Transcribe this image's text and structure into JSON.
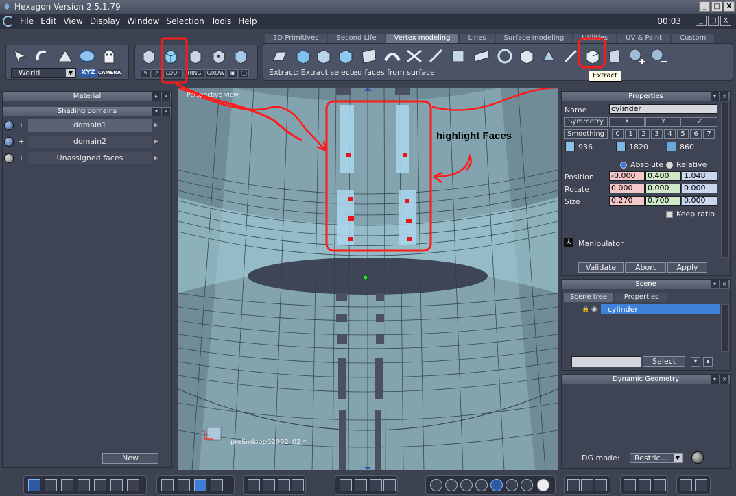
{
  "window": {
    "title": "Hexagon Version 2.5.1.79"
  },
  "menu": {
    "items": [
      "File",
      "Edit",
      "View",
      "Display",
      "Window",
      "Selection",
      "Tools",
      "Help"
    ],
    "timer": "00:03"
  },
  "tabs": [
    "3D Primitives",
    "Second Life",
    "Vertex modeling",
    "Lines",
    "Surface modeling",
    "Utilities",
    "UV & Paint",
    "Custom"
  ],
  "active_tab": "Vertex modeling",
  "toolbar": {
    "coord_system": "World",
    "xyz_label": "XYZ",
    "camera_label": "CAMERA",
    "sel_buttons": [
      "LOOP",
      "RING",
      "GROW"
    ],
    "status": "Extract: Extract selected faces from surface",
    "tooltip": "Extract"
  },
  "left_panel": {
    "material_title": "Material",
    "shading_title": "Shading domains",
    "domains": [
      "domain1",
      "domain2",
      "Unassigned faces"
    ],
    "new_label": "New"
  },
  "viewport": {
    "label": "Perspective view",
    "object_label": "prelimloop02002_02 *",
    "annotation": "highlight Faces",
    "colors": {
      "mesh": "#7ea4b0",
      "highlight": "#a8d2ea",
      "annotation": "#ff1a1a"
    }
  },
  "properties": {
    "title": "Properties",
    "name_label": "Name",
    "name_value": "cylinder",
    "symmetry_label": "Symmetry",
    "axes": [
      "X",
      "Y",
      "Z"
    ],
    "smoothing_label": "Smoothing",
    "smoothing_levels": [
      "0",
      "1",
      "2",
      "3",
      "4",
      "5",
      "6",
      "7"
    ],
    "counts": [
      "936",
      "1820",
      "860"
    ],
    "absolute_label": "Absolute",
    "relative_label": "Relative",
    "position_label": "Position",
    "rotate_label": "Rotate",
    "size_label": "Size",
    "position": [
      "-0.000",
      "0.400",
      "1.048"
    ],
    "rotate": [
      "0.000",
      "0.000",
      "0.000"
    ],
    "size": [
      "0.270",
      "0.700",
      "0.000"
    ],
    "keep_ratio_label": "Keep ratio",
    "manipulator_label": "Manipulator",
    "buttons": [
      "Validate",
      "Abort",
      "Apply"
    ]
  },
  "scene": {
    "title": "Scene",
    "tabs": [
      "Scene tree",
      "Properties"
    ],
    "item": "cylinder",
    "select_label": "Select"
  },
  "dynamic_geometry": {
    "title": "Dynamic Geometry",
    "mode_label": "DG mode:",
    "mode_value": "Restric..."
  }
}
